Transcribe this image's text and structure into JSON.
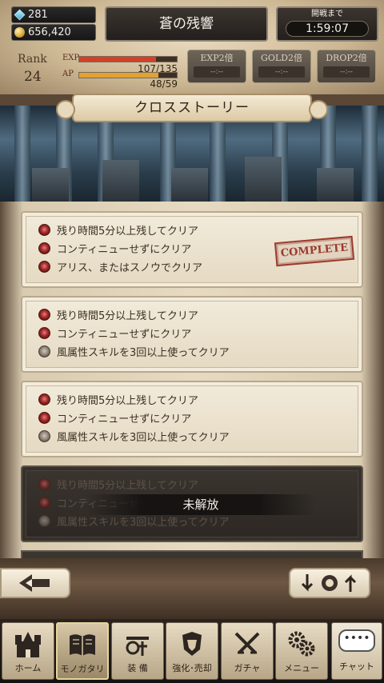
{
  "header": {
    "gems": "281",
    "gold": "656,420",
    "stage_title": "蒼の残響",
    "timer_label": "開戦まで",
    "timer_value": "1:59:07",
    "rank_label": "Rank",
    "rank_value": "24",
    "exp_label": "EXP",
    "exp_value": "107/135",
    "exp_fraction": 0.79,
    "ap_label": "AP",
    "ap_value": "48/59",
    "ap_fraction": 0.81,
    "boosts": [
      {
        "label": "EXP2倍",
        "value": "--:--"
      },
      {
        "label": "GOLD2倍",
        "value": "--:--"
      },
      {
        "label": "DROP2倍",
        "value": "--:--"
      }
    ]
  },
  "section_title": "クロスストーリー",
  "missions": [
    {
      "rows": [
        "残り時間5分以上残してクリア",
        "コンティニューせずにクリア",
        "アリス、またはスノウでクリア"
      ],
      "stamp": "COMPLETE"
    },
    {
      "rows": [
        "残り時間5分以上残してクリア",
        "コンティニューせずにクリア",
        "風属性スキルを3回以上使ってクリア"
      ]
    },
    {
      "rows": [
        "残り時間5分以上残してクリア",
        "コンティニューせずにクリア",
        "風属性スキルを3回以上使ってクリア"
      ]
    },
    {
      "rows": [
        "残り時間5分以上残してクリア",
        "コンティニューせずにクリア",
        "風属性スキルを3回以上使ってクリア"
      ],
      "locked_label": "未解放"
    }
  ],
  "nav": [
    {
      "label": "ホーム",
      "icon": "castle-icon"
    },
    {
      "label": "モノガタリ",
      "icon": "book-icon"
    },
    {
      "label": "装 備",
      "icon": "equipment-icon"
    },
    {
      "label": "強化･売却",
      "icon": "armor-icon"
    },
    {
      "label": "ガチャ",
      "icon": "swords-icon"
    },
    {
      "label": "メニュー",
      "icon": "gears-icon"
    }
  ],
  "chat": {
    "label": "チャット",
    "bubble": "••••"
  },
  "colors": {
    "exp_bar": "#d2402a",
    "ap_bar": "#e0a232",
    "stamp": "#9a3b2e"
  }
}
